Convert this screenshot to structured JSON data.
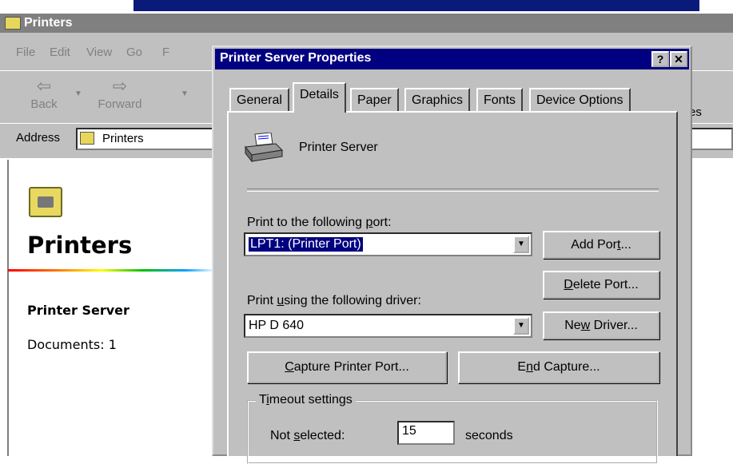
{
  "explorer": {
    "title": "Printers",
    "menu": [
      "File",
      "Edit",
      "View",
      "Go",
      "F"
    ],
    "toolbar": {
      "back": "Back",
      "forward": "Forward",
      "fragment": "es"
    },
    "address": {
      "label": "Address",
      "value": "Printers"
    },
    "content": {
      "folder_title": "Printers",
      "selected_name": "Printer Server",
      "selected_docs": "Documents: 1"
    }
  },
  "dialog": {
    "title": "Printer Server Properties",
    "help_button": "?",
    "close_button": "✕",
    "tabs": [
      "General",
      "Details",
      "Paper",
      "Graphics",
      "Fonts",
      "Device Options"
    ],
    "active_tab": "Details",
    "printer_name": "Printer Server",
    "port_label": "Print to the following port:",
    "port_value": "LPT1:  (Printer Port)",
    "driver_label": "Print using the following driver:",
    "driver_value": "HP D 640",
    "buttons": {
      "add_port": "Add Port...",
      "delete_port": "Delete Port...",
      "new_driver": "New Driver...",
      "capture": "Capture Printer Port...",
      "end_capture": "End Capture..."
    },
    "timeout": {
      "group_title": "Timeout settings",
      "not_selected_label": "Not selected:",
      "not_selected_value": "15",
      "unit": "seconds"
    }
  }
}
